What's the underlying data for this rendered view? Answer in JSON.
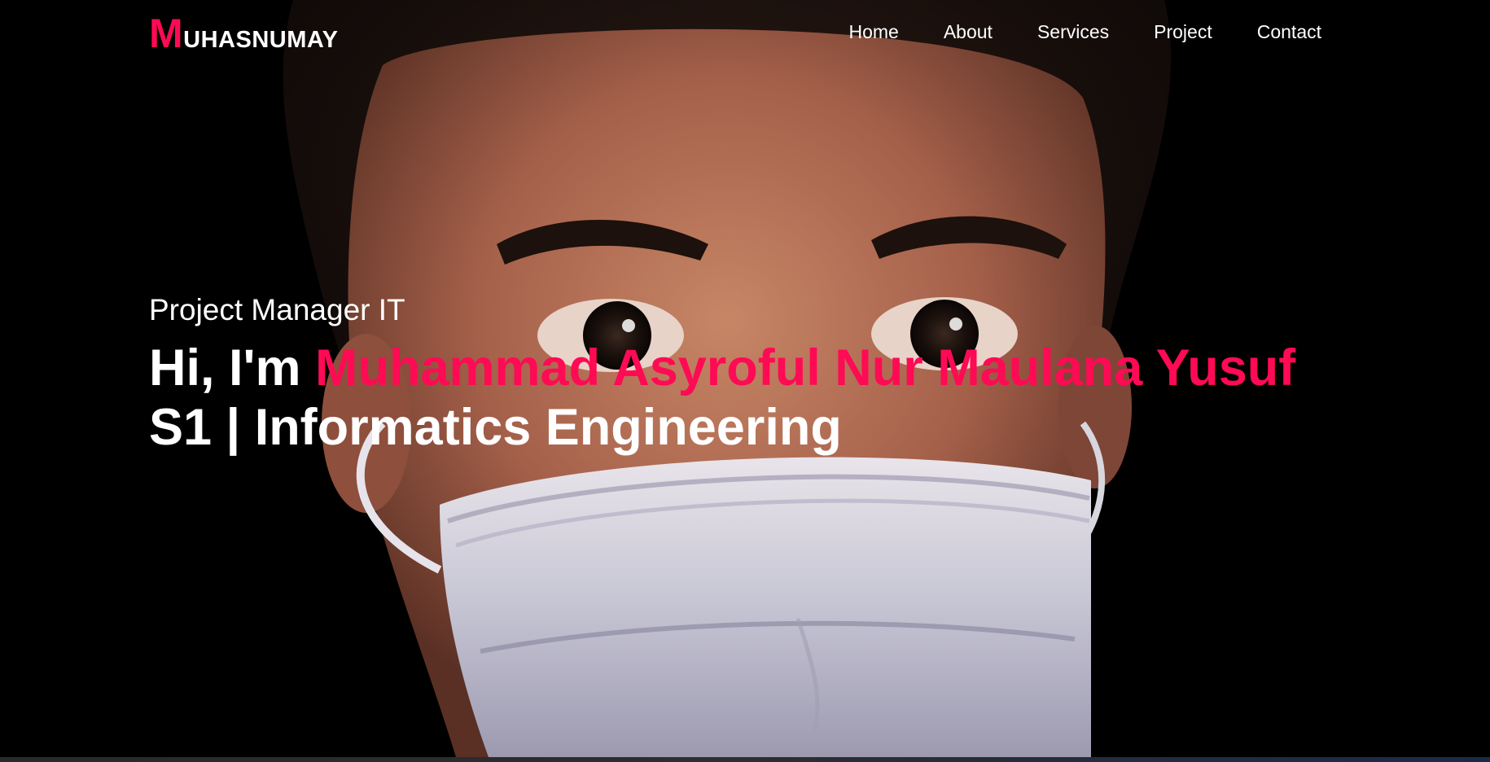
{
  "brand": {
    "initial": "M",
    "rest": "UHASNUMAY",
    "accent_color": "#ff0a54"
  },
  "nav": {
    "items": [
      {
        "label": "Home"
      },
      {
        "label": "About"
      },
      {
        "label": "Services"
      },
      {
        "label": "Project"
      },
      {
        "label": "Contact"
      }
    ]
  },
  "hero": {
    "subtitle": "Project Manager IT",
    "greeting": "Hi, I'm ",
    "name": "Muhammad Asyroful Nur Maulana Yusuf",
    "degree": "S1 | Informatics Engineering",
    "background_image": "portrait of a young man wearing a surgical face mask on black background"
  }
}
